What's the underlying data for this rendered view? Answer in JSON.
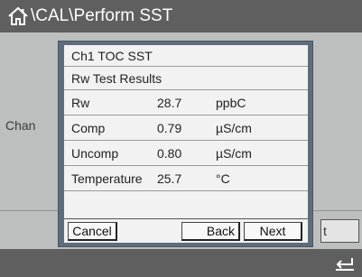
{
  "header": {
    "separator1": "\\",
    "cal": "CAL",
    "separator2": "\\",
    "page": "Perform SST",
    "home_icon": "home-icon"
  },
  "background": {
    "side_label": "Chan",
    "right_button_label": "t"
  },
  "dialog": {
    "title": "Ch1 TOC SST",
    "subtitle": "Rw Test Results",
    "rows": [
      {
        "name": "Rw",
        "value": "28.7",
        "unit": "ppbC"
      },
      {
        "name": "Comp",
        "value": "0.79",
        "unit": "µS/cm"
      },
      {
        "name": "Uncomp",
        "value": "0.80",
        "unit": "µS/cm"
      },
      {
        "name": "Temperature",
        "value": "25.7",
        "unit": "°C"
      }
    ],
    "buttons": {
      "cancel": "Cancel",
      "back": "Back",
      "next": "Next"
    }
  },
  "footer": {
    "enter_icon": "enter-icon"
  },
  "colors": {
    "bar": "#5f5f5f",
    "dialog_frame": "#5e6d7c",
    "dialog_body": "#f2f2f2",
    "screen_bg": "#bcbfbd"
  }
}
